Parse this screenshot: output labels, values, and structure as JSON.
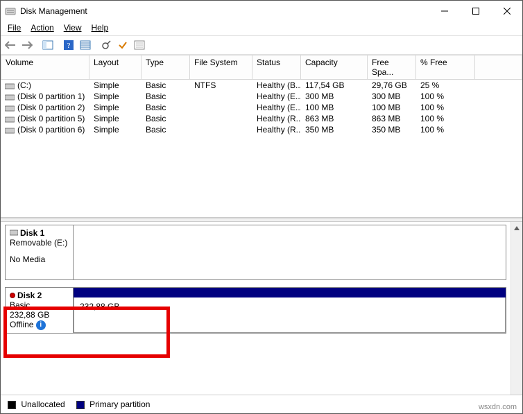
{
  "window": {
    "title": "Disk Management"
  },
  "menu": {
    "file": "File",
    "action": "Action",
    "view": "View",
    "help": "Help"
  },
  "grid": {
    "headers": {
      "volume": "Volume",
      "layout": "Layout",
      "type": "Type",
      "filesystem": "File System",
      "status": "Status",
      "capacity": "Capacity",
      "free": "Free Spa...",
      "pctfree": "% Free"
    },
    "rows": [
      {
        "volume": "(C:)",
        "layout": "Simple",
        "type": "Basic",
        "fs": "NTFS",
        "status": "Healthy (B...",
        "capacity": "117,54 GB",
        "free": "29,76 GB",
        "pct": "25 %"
      },
      {
        "volume": "(Disk 0 partition 1)",
        "layout": "Simple",
        "type": "Basic",
        "fs": "",
        "status": "Healthy (E...",
        "capacity": "300 MB",
        "free": "300 MB",
        "pct": "100 %"
      },
      {
        "volume": "(Disk 0 partition 2)",
        "layout": "Simple",
        "type": "Basic",
        "fs": "",
        "status": "Healthy (E...",
        "capacity": "100 MB",
        "free": "100 MB",
        "pct": "100 %"
      },
      {
        "volume": "(Disk 0 partition 5)",
        "layout": "Simple",
        "type": "Basic",
        "fs": "",
        "status": "Healthy (R...",
        "capacity": "863 MB",
        "free": "863 MB",
        "pct": "100 %"
      },
      {
        "volume": "(Disk 0 partition 6)",
        "layout": "Simple",
        "type": "Basic",
        "fs": "",
        "status": "Healthy (R...",
        "capacity": "350 MB",
        "free": "350 MB",
        "pct": "100 %"
      }
    ]
  },
  "graphical": {
    "disk1": {
      "name": "Disk 1",
      "removable": "Removable (E:)",
      "nomedia": "No Media"
    },
    "disk2": {
      "name": "Disk 2",
      "type": "Basic",
      "size": "232,88 GB",
      "status": "Offline",
      "part_size": "232,88 GB"
    }
  },
  "legend": {
    "unalloc": "Unallocated",
    "primary": "Primary partition"
  },
  "watermark": "wsxdn.com"
}
